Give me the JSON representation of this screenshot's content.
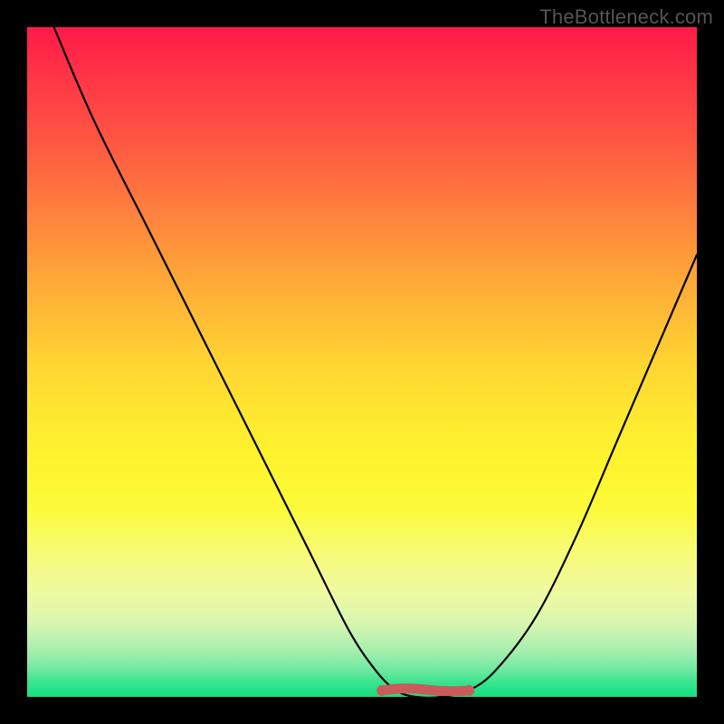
{
  "watermark": "TheBottleneck.com",
  "colors": {
    "frame": "#000000",
    "curve": "#000000",
    "marker": "#c95b5b",
    "gradient_top": "#ff1a4a",
    "gradient_bottom": "#14e080"
  },
  "chart_data": {
    "type": "line",
    "title": "",
    "xlabel": "",
    "ylabel": "",
    "xlim": [
      0,
      100
    ],
    "ylim": [
      0,
      100
    ],
    "grid": false,
    "series": [
      {
        "name": "bottleneck-curve",
        "x": [
          4,
          10,
          18,
          26,
          34,
          42,
          48,
          52,
          55,
          58,
          62,
          66,
          70,
          76,
          82,
          88,
          94,
          100
        ],
        "values": [
          100,
          86,
          70,
          54,
          38,
          22,
          10,
          4,
          1,
          0,
          0,
          1,
          4,
          12,
          24,
          38,
          52,
          66
        ]
      }
    ],
    "markers": [
      {
        "name": "optimal-range",
        "x_start": 53,
        "x_end": 66,
        "y": 0
      }
    ],
    "legend": false
  }
}
